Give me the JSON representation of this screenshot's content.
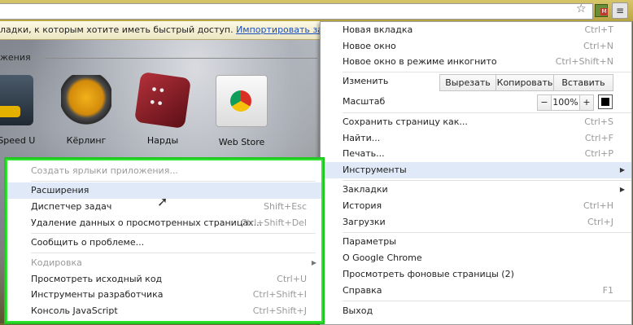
{
  "bookmarks_bar": {
    "prompt": "ладки, к которым хотите иметь быстрый доступ.",
    "import_link": "Импортировать закладки..."
  },
  "ntp": {
    "apps_heading": "жения",
    "apps": [
      {
        "label": "For Speed U",
        "icon": "racing-game-icon"
      },
      {
        "label": "Кёрлинг",
        "icon": "curling-stone-icon"
      },
      {
        "label": "Нарды",
        "icon": "dice-icon"
      },
      {
        "label": "Web Store",
        "icon": "chrome-web-store-icon"
      }
    ]
  },
  "menu": {
    "new_tab": {
      "label": "Новая вкладка",
      "shortcut": "Ctrl+T"
    },
    "new_window": {
      "label": "Новое окно",
      "shortcut": "Ctrl+N"
    },
    "incognito": {
      "label": "Новое окно в режиме инкогнито",
      "shortcut": "Ctrl+Shift+N"
    },
    "edit": {
      "label": "Изменить",
      "cut": "Вырезать",
      "copy": "Копировать",
      "paste": "Вставить"
    },
    "zoom": {
      "label": "Масштаб",
      "minus": "−",
      "value": "100%",
      "plus": "+"
    },
    "save_page": {
      "label": "Сохранить страницу как...",
      "shortcut": "Ctrl+S"
    },
    "find": {
      "label": "Найти...",
      "shortcut": "Ctrl+F"
    },
    "print": {
      "label": "Печать...",
      "shortcut": "Ctrl+P"
    },
    "tools": {
      "label": "Инструменты"
    },
    "bookmarks": {
      "label": "Закладки"
    },
    "history": {
      "label": "История",
      "shortcut": "Ctrl+H"
    },
    "downloads": {
      "label": "Загрузки",
      "shortcut": "Ctrl+J"
    },
    "settings": {
      "label": "Параметры"
    },
    "about": {
      "label": "О Google Chrome"
    },
    "background_pages": {
      "label": "Просмотреть фоновые страницы (2)"
    },
    "help": {
      "label": "Справка",
      "shortcut": "F1"
    },
    "exit": {
      "label": "Выход"
    }
  },
  "tools_menu": {
    "create_shortcuts": {
      "label": "Создать ярлыки приложения..."
    },
    "extensions": {
      "label": "Расширения"
    },
    "task_manager": {
      "label": "Диспетчер задач",
      "shortcut": "Shift+Esc"
    },
    "clear_data": {
      "label": "Удаление данных о просмотренных страницах...",
      "shortcut": "Ctrl+Shift+Del"
    },
    "report_issue": {
      "label": "Сообщить о проблеме..."
    },
    "encoding": {
      "label": "Кодировка"
    },
    "view_source": {
      "label": "Просмотреть исходный код",
      "shortcut": "Ctrl+U"
    },
    "dev_tools": {
      "label": "Инструменты разработчика",
      "shortcut": "Ctrl+Shift+I"
    },
    "js_console": {
      "label": "Консоль JavaScript",
      "shortcut": "Ctrl+Shift+J"
    }
  },
  "colors": {
    "highlight_border": "#2ee52e",
    "selection": "#dfe9f7"
  }
}
